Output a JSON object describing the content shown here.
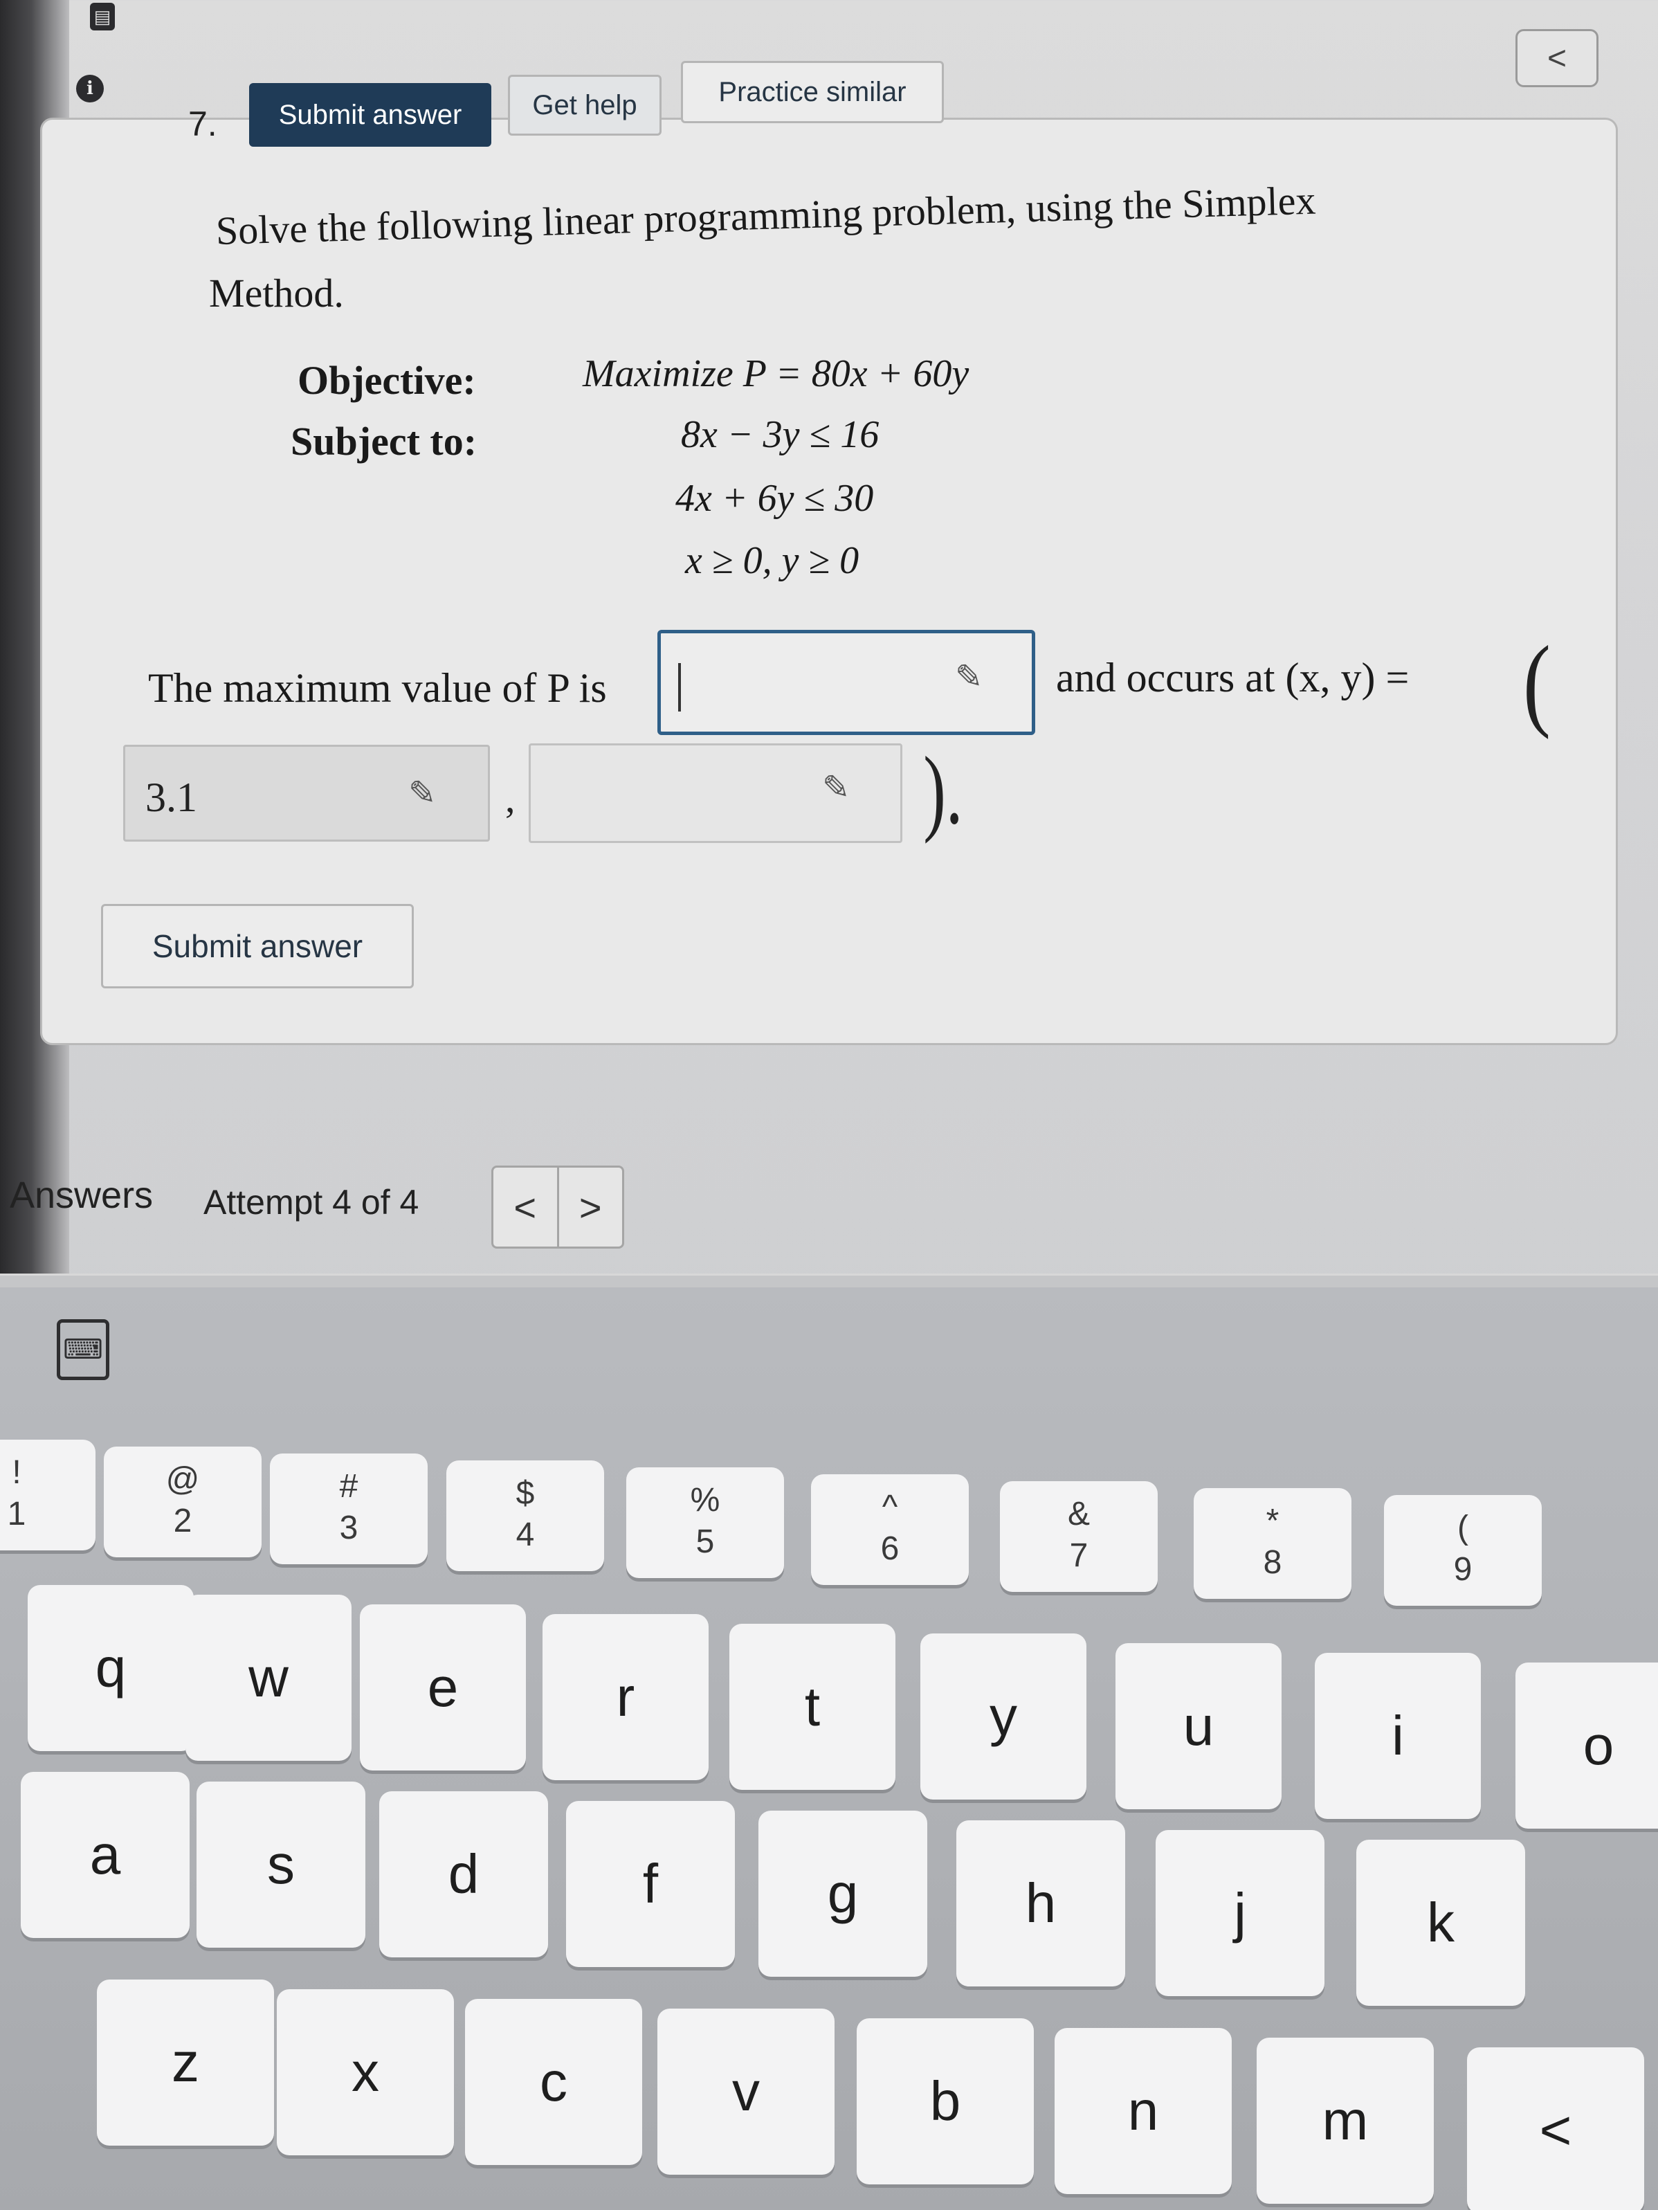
{
  "toolbar": {
    "question_number": "7.",
    "submit_label": "Submit answer",
    "help_label": "Get help",
    "similar_label": "Practice similar",
    "collapse_label": "<"
  },
  "problem": {
    "prompt_line1": "Solve the following linear programming problem, using the Simplex",
    "prompt_line2": "Method.",
    "objective_label": "Objective:",
    "subject_label": "Subject to:",
    "objective": "Maximize P = 80x + 60y",
    "constraints": [
      "8x − 3y ≤ 16",
      "4x + 6y ≤ 30",
      "x ≥ 0, y ≥ 0"
    ]
  },
  "answer": {
    "max_text": "The maximum value of P is",
    "occurs_text": "and occurs at (x, y) =",
    "open_paren": "(",
    "close_paren": ").",
    "comma": ",",
    "max_value": "",
    "x_value": "3.1",
    "y_value": ""
  },
  "footer": {
    "submit_label": "Submit answer",
    "answers_label": "Answers",
    "attempt_label": "Attempt 4 of 4",
    "prev": "<",
    "next": ">"
  },
  "keyboard": {
    "number_row": [
      {
        "top": "!",
        "bottom": "1"
      },
      {
        "top": "@",
        "bottom": "2"
      },
      {
        "top": "#",
        "bottom": "3"
      },
      {
        "top": "$",
        "bottom": "4"
      },
      {
        "top": "%",
        "bottom": "5"
      },
      {
        "top": "^",
        "bottom": "6"
      },
      {
        "top": "&",
        "bottom": "7"
      },
      {
        "top": "*",
        "bottom": "8"
      },
      {
        "top": "(",
        "bottom": "9"
      }
    ],
    "row1": [
      "q",
      "w",
      "e",
      "r",
      "t",
      "y",
      "u",
      "i",
      "o"
    ],
    "row2": [
      "a",
      "s",
      "d",
      "f",
      "g",
      "h",
      "j",
      "k"
    ],
    "row3": [
      "z",
      "x",
      "c",
      "v",
      "b",
      "n",
      "m",
      "<"
    ]
  }
}
